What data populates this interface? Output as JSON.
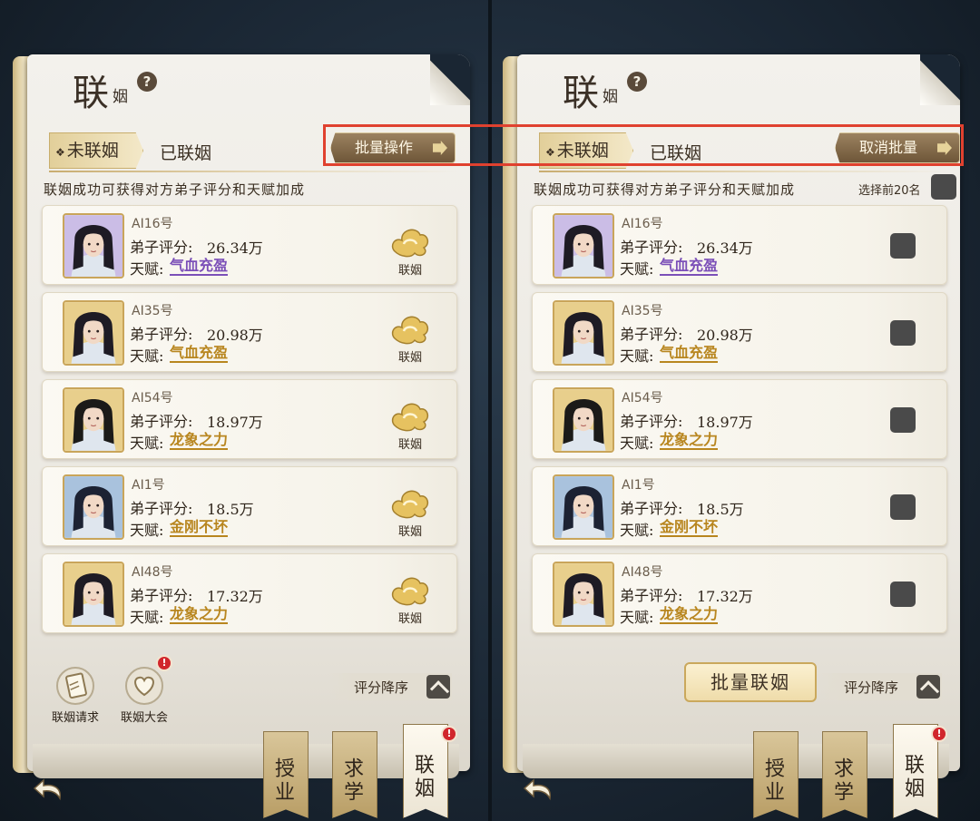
{
  "title": {
    "main": "联",
    "sub": "姻",
    "help": "?"
  },
  "tabs": {
    "unmarried": "未联姻",
    "married": "已联姻",
    "bullet": "❖"
  },
  "left": {
    "batch_button": "批量操作",
    "info": "联姻成功可获得对方弟子评分和天赋加成",
    "sort_label": "评分降序",
    "bottom_icons": [
      {
        "label": "联姻请求"
      },
      {
        "label": "联姻大会",
        "badge": "!"
      }
    ]
  },
  "right": {
    "batch_button": "取消批量",
    "info": "联姻成功可获得对方弟子评分和天赋加成",
    "select_top": "选择前20名",
    "batch_marry": "批量联姻",
    "sort_label": "评分降序"
  },
  "list": [
    {
      "name": "AI16号",
      "score_label": "弟子评分:",
      "score": "26.34万",
      "talent_label": "天赋:",
      "talent": "气血充盈",
      "talent_color": "#7b4fb8",
      "avatar_bg": "#cbbde6",
      "hair": "#1e1b24"
    },
    {
      "name": "AI35号",
      "score_label": "弟子评分:",
      "score": "20.98万",
      "talent_label": "天赋:",
      "talent": "气血充盈",
      "talent_color": "#b8861f",
      "avatar_bg": "#e8cf8c",
      "hair": "#1e1b24"
    },
    {
      "name": "AI54号",
      "score_label": "弟子评分:",
      "score": "18.97万",
      "talent_label": "天赋:",
      "talent": "龙象之力",
      "talent_color": "#b8861f",
      "avatar_bg": "#e8cf8c",
      "hair": "#1b1a18"
    },
    {
      "name": "AI1号",
      "score_label": "弟子评分:",
      "score": "18.5万",
      "talent_label": "天赋:",
      "talent": "金刚不坏",
      "talent_color": "#b8861f",
      "avatar_bg": "#a9c2dd",
      "hair": "#1c2233"
    },
    {
      "name": "AI48号",
      "score_label": "弟子评分:",
      "score": "17.32万",
      "talent_label": "天赋:",
      "talent": "龙象之力",
      "talent_color": "#b8861f",
      "avatar_bg": "#e8cf8c",
      "hair": "#1e1b24"
    }
  ],
  "marry_label": "联姻",
  "bookmarks": [
    {
      "label": "授业"
    },
    {
      "label": "求学"
    },
    {
      "label": "联姻",
      "badge": "!"
    }
  ],
  "colors": {
    "highlight": "#e0412f",
    "accent_gold": "#caa85c"
  },
  "icons": [
    "help-icon",
    "arrow-icon",
    "cloud-icon",
    "letter-icon",
    "hearts-icon",
    "back-arrow-icon"
  ]
}
